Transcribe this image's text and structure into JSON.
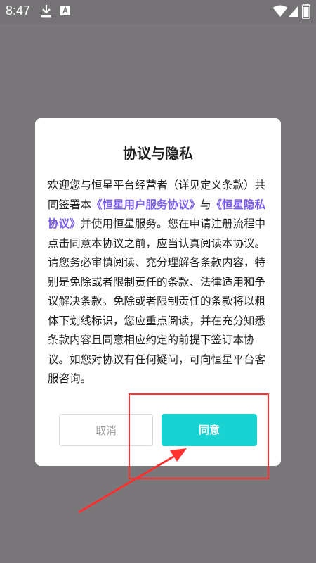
{
  "status_bar": {
    "time": "8:47",
    "icons": [
      "download-icon",
      "app-notification-icon",
      "wifi-icon",
      "signal-icon",
      "battery-icon"
    ]
  },
  "dialog": {
    "title": "协议与隐私",
    "body": {
      "seg1": "欢迎您与恒星平台经营者（详见定义条款）共同签署本",
      "link_user_agreement": "《恒星用户服务协议》",
      "seg2": "与",
      "link_privacy_agreement": "《恒星隐私协议》",
      "seg3": "并使用恒星服务。您在申请注册流程中点击同意本协议之前，应当认真阅读本协议。请您务必审慎阅读、充分理解各条款内容，特别是免除或者限制责任的条款、法律适用和争议解决条款。免除或者限制责任的条款将以粗体下划线标识，您应重点阅读，并在充分知悉条款内容且同意相应约定的前提下签订本协议。如您对协议有任何疑问，可向恒星平台客服咨询。"
    },
    "cancel_label": "取消",
    "agree_label": "同意"
  },
  "colors": {
    "overlay": "#7a777a",
    "link": "#7b5cf0",
    "agree_button": "#19d3d3",
    "annotation": "#ff3030"
  }
}
